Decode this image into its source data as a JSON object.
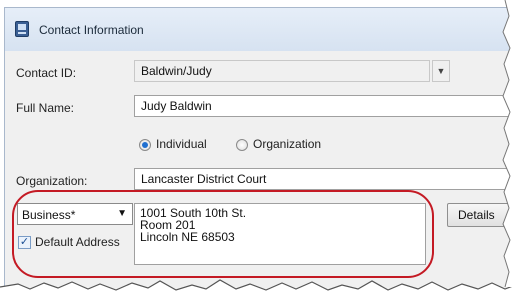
{
  "window": {
    "title": "Contact Information"
  },
  "contact_id": {
    "label": "Contact ID:",
    "value": "Baldwin/Judy"
  },
  "full_name": {
    "label": "Full Name:",
    "value": "Judy Baldwin"
  },
  "entity_type": {
    "individual_label": "Individual",
    "organization_label": "Organization",
    "selected": "Individual"
  },
  "organization": {
    "label": "Organization:",
    "value": "Lancaster District Court"
  },
  "address": {
    "type_value": "Business*",
    "default_label": "Default Address",
    "default_checked": true,
    "lines": [
      "1001 South 10th St.",
      "Room 201",
      "Lincoln NE  68503"
    ],
    "details_label": "Details"
  },
  "colors": {
    "highlight": "#c41a24",
    "title_bg": "#dfe8f5",
    "dialog_bg": "#f0f0f0"
  }
}
